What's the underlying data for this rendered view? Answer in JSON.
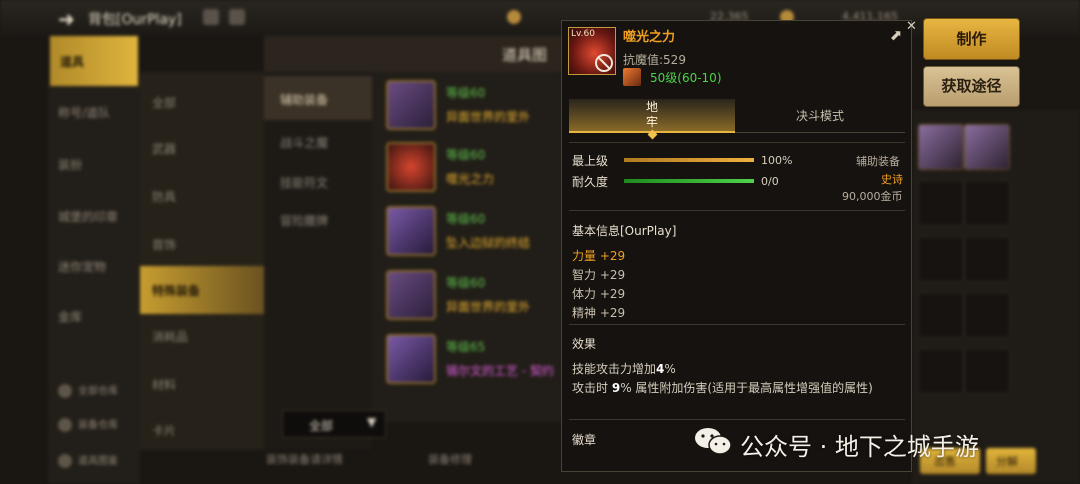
{
  "background": {
    "title": "背包[OurPlay]",
    "currency_a": "22,365",
    "currency_b": "4,411,165",
    "header_title": "道具图",
    "left_nav": [
      "道具",
      "称号/道队",
      "装扮",
      "城堡的印章",
      "迷你宠物",
      "金库"
    ],
    "left_nav_bottom": [
      "全部仓库",
      "装备仓库",
      "道具图鉴"
    ],
    "sub_nav": [
      "全部",
      "武器",
      "防具",
      "首饰",
      "特殊装备",
      "消耗品",
      "材料",
      "卡片"
    ],
    "categories": [
      "辅助装备",
      "战斗之魔",
      "技能符文",
      "冒险腰牌"
    ],
    "items": [
      {
        "level": "等级60",
        "name": "异面世界的里外"
      },
      {
        "level": "等级60",
        "name": "噬光之力"
      },
      {
        "level": "等级60",
        "name": "坠入边狱的终结"
      },
      {
        "level": "等级60",
        "name": "异面世界的里外"
      },
      {
        "level": "等级65",
        "name": "锡尔文的工艺 - 契约"
      }
    ],
    "dropdown_label": "全部",
    "bottom_actions": [
      "装饰装备请详情",
      "装备修理"
    ],
    "bottom_buttons": [
      "出售",
      "分解"
    ]
  },
  "actions": {
    "make_label": "制作",
    "source_label": "获取途径"
  },
  "tooltip": {
    "icon_level": "Lv.60",
    "item_name": "噬光之力",
    "resist": "抗魔值:529",
    "level_req": "50级(60-10)",
    "tabs": {
      "dungeon": "地\n牢",
      "duel": "决斗模式"
    },
    "grade": {
      "label": "最上级",
      "value": "100%",
      "fill": 1.0
    },
    "durability": {
      "label": "耐久度",
      "value": "0/0",
      "fill": 1.0
    },
    "type": "辅助装备",
    "rarity": "史诗",
    "price": "90,000金币",
    "basic_title": "基本信息[OurPlay]",
    "stats": [
      "力量 +29",
      "智力 +29",
      "体力 +29",
      "精神 +29"
    ],
    "effect_title": "效果",
    "effects": [
      {
        "pre": "技能攻击力增加",
        "num": "4",
        "post": "%"
      },
      {
        "pre": "攻击时 ",
        "num": "9",
        "post": "% 属性附加伤害(适用于最高属性增强值的属性)"
      }
    ],
    "badge_title": "徽章"
  },
  "watermark": {
    "text": "公众号 · 地下之城手游"
  },
  "colors": {
    "gold": "#f0a020",
    "green": "#4ed24a",
    "bar_orange": "#e8a030",
    "bar_green": "#3ec43a"
  }
}
